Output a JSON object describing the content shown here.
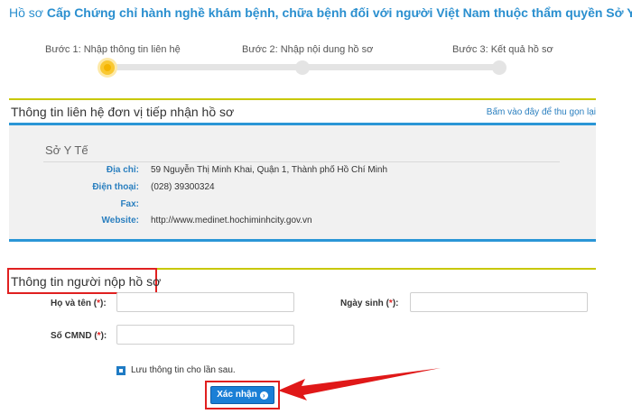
{
  "header": {
    "prefix": "Hồ sơ",
    "title": "Cấp Chứng chỉ hành nghề khám bệnh, chữa bệnh đối với người Việt Nam thuộc thẩm quyền Sở Y tế"
  },
  "stepper": {
    "steps": [
      {
        "label": "Bước 1: Nhập thông tin liên hệ"
      },
      {
        "label": "Bước 2: Nhập nội dung hồ sơ"
      },
      {
        "label": "Bước 3: Kết quả hồ sơ"
      }
    ],
    "active_step": 1
  },
  "contact_section": {
    "title": "Thông tin liên hệ đơn vị tiếp nhận hồ sơ",
    "collapse_link": "Bấm vào đây để thu gọn lại",
    "org_name": "Sở Y Tế",
    "rows": [
      {
        "label": "Địa chỉ:",
        "value": "59 Nguyễn Thị Minh Khai, Quận 1, Thành phố Hồ Chí Minh"
      },
      {
        "label": "Điện thoại:",
        "value": "(028) 39300324"
      },
      {
        "label": "Fax:",
        "value": ""
      },
      {
        "label": "Website:",
        "value": "http://www.medinet.hochiminhcity.gov.vn"
      }
    ]
  },
  "submitter_section": {
    "title": "Thông tin người nộp hồ sơ",
    "full_name_label": "Họ và tên",
    "full_name_value": "",
    "dob_label": "Ngày sinh",
    "dob_value": "",
    "id_label": "Số CMND",
    "id_value": "",
    "required_mark": "*",
    "remember_label": "Lưu thông tin cho lần sau.",
    "remember_checked": true,
    "submit_label": "Xác nhận"
  },
  "colors": {
    "accent": "#2a8fcf",
    "section_rule": "#c8c800",
    "highlight": "#e02020",
    "button": "#1a7fd6",
    "active_step": "#f9c832"
  }
}
